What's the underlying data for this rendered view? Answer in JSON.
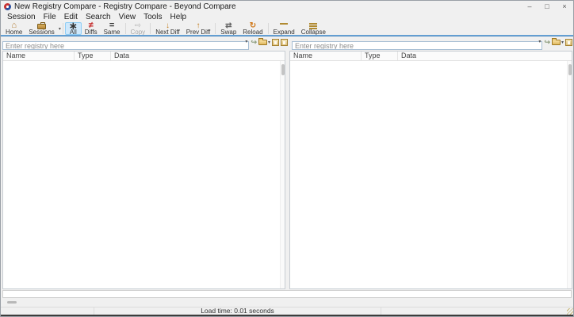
{
  "window": {
    "title": "New Registry Compare - Registry Compare - Beyond Compare",
    "controls": {
      "minimize": "–",
      "maximize": "□",
      "close": "×"
    }
  },
  "menu": {
    "items": [
      {
        "label": "Session"
      },
      {
        "label": "File"
      },
      {
        "label": "Edit"
      },
      {
        "label": "Search"
      },
      {
        "label": "View"
      },
      {
        "label": "Tools"
      },
      {
        "label": "Help"
      }
    ]
  },
  "toolbar": {
    "items": [
      {
        "label": "Home"
      },
      {
        "label": "Sessions"
      },
      {
        "label": "All",
        "selected": true
      },
      {
        "label": "Diffs"
      },
      {
        "label": "Same"
      },
      {
        "label": "Copy",
        "disabled": true
      },
      {
        "label": "Next Diff"
      },
      {
        "label": "Prev Diff"
      },
      {
        "label": "Swap"
      },
      {
        "label": "Reload"
      },
      {
        "label": "Expand"
      },
      {
        "label": "Collapse"
      }
    ]
  },
  "panes": {
    "left": {
      "placeholder": "Enter registry here",
      "columns": [
        "Name",
        "Type",
        "Data"
      ]
    },
    "right": {
      "placeholder": "Enter registry here",
      "columns": [
        "Name",
        "Type",
        "Data"
      ]
    }
  },
  "status_bar": {
    "load_time": "Load time: 0.01 seconds"
  },
  "icons": {
    "dropdown": "▾",
    "swoosh": "↪",
    "home": "⌂",
    "asterisk": "∗",
    "not_equal": "≠",
    "equal": "=",
    "copy": "⇨",
    "next_diff": "↓",
    "prev_diff": "↑",
    "swap": "⇄",
    "reload": "↻"
  },
  "colors": {
    "accent_blue": "#4a86c0",
    "selected_button_bg": "#cfe8fb",
    "selected_button_border": "#8ecdf5",
    "gold_icon": "#b5823c",
    "diff_red": "#c32525",
    "window_chrome": "#f0f0f0"
  }
}
